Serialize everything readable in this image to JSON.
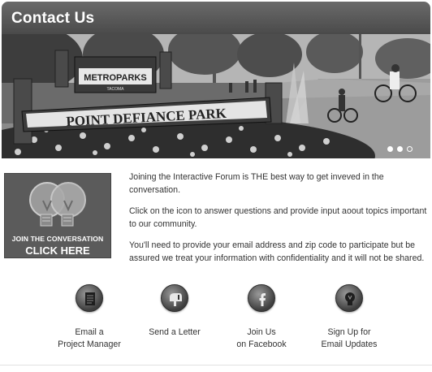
{
  "header": {
    "title": "Contact Us"
  },
  "hero": {
    "sign_logo": "METROPARKS",
    "sign_logo_sub": "TACOMA",
    "sign_name": "POINT DEFIANCE PARK",
    "slides": {
      "count": 3,
      "active": 2
    }
  },
  "join": {
    "line1": "JOIN THE CONVERSATION",
    "line2": "CLICK HERE"
  },
  "intro": {
    "p1": "Joining the Interactive Forum is THE best way to get inveved in the conversation.",
    "p2": "Click on the icon to answer questions and provide input aoout topics important to our community.",
    "p3": "You'll need to provide your email address and zip code to participate but be assured we treat your information with confidentiality and it will not be shared."
  },
  "actions": [
    {
      "line1": "Email a",
      "line2": "Project Manager",
      "icon": "document-icon"
    },
    {
      "line1": "Send a Letter",
      "line2": "",
      "icon": "mailbox-icon"
    },
    {
      "line1": "Join Us",
      "line2": "on Facebook",
      "icon": "facebook-icon"
    },
    {
      "line1": "Sign Up for",
      "line2": "Email Updates",
      "icon": "bulb-icon"
    }
  ]
}
